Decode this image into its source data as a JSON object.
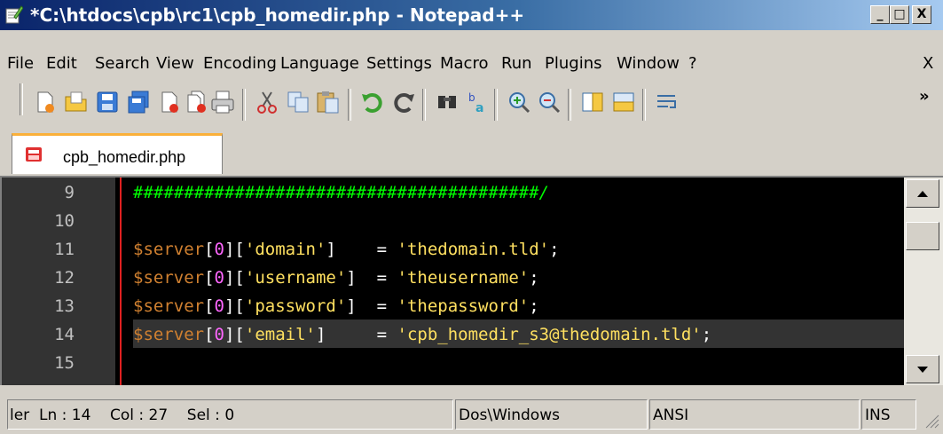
{
  "window": {
    "title": "*C:\\htdocs\\cpb\\rc1\\cpb_homedir.php - Notepad++",
    "minimize": "_",
    "maximize": "□",
    "close": "X"
  },
  "menu": [
    {
      "label": "File"
    },
    {
      "label": "Edit"
    },
    {
      "label": "Search"
    },
    {
      "label": "View"
    },
    {
      "label": "Encoding"
    },
    {
      "label": "Language"
    },
    {
      "label": "Settings"
    },
    {
      "label": "Macro"
    },
    {
      "label": "Run"
    },
    {
      "label": "Plugins"
    },
    {
      "label": "Window"
    },
    {
      "label": "?"
    }
  ],
  "menu_close": "X",
  "toolbar_overflow": "»",
  "toolbar_icons": [
    "new-file-icon",
    "open-file-icon",
    "save-icon",
    "save-all-icon",
    "close-icon",
    "close-all-icon",
    "print-icon",
    "cut-icon",
    "copy-icon",
    "paste-icon",
    "undo-icon",
    "redo-icon",
    "find-icon",
    "replace-icon",
    "zoom-in-icon",
    "zoom-out-icon",
    "sync-vertical-icon",
    "sync-horizontal-icon",
    "word-wrap-icon"
  ],
  "tab": {
    "label": "cpb_homedir.php",
    "icon": "unsaved-file-icon"
  },
  "editor": {
    "lines": [
      {
        "num": "9",
        "comment": "########################################/"
      },
      {
        "num": "10"
      },
      {
        "num": "11",
        "var": "$server",
        "b1": "[",
        "idx": "0",
        "b2": "][",
        "key": "'domain'",
        "b3": "]",
        "pad": "   ",
        "op": "=",
        "val": "'thedomain.tld'",
        "end": ";"
      },
      {
        "num": "12",
        "var": "$server",
        "b1": "[",
        "idx": "0",
        "b2": "][",
        "key": "'username'",
        "b3": "]",
        "pad": " ",
        "op": "=",
        "val": "'theusername'",
        "end": ";"
      },
      {
        "num": "13",
        "var": "$server",
        "b1": "[",
        "idx": "0",
        "b2": "][",
        "key": "'password'",
        "b3": "]",
        "pad": " ",
        "op": "=",
        "val": "'thepassword'",
        "end": ";"
      },
      {
        "num": "14",
        "var": "$server",
        "b1": "[",
        "idx": "0",
        "b2": "][",
        "key": "'email'",
        "b3": "]",
        "pad": "    ",
        "op": "=",
        "val": "'cpb_homedir_s3@thedomain.tld'",
        "end": ";"
      },
      {
        "num": "15"
      }
    ]
  },
  "status": {
    "lang": "ler",
    "pos": "Ln : 14    Col : 27    Sel : 0",
    "eol": "Dos\\Windows",
    "encoding": "ANSI",
    "mode": "INS"
  }
}
